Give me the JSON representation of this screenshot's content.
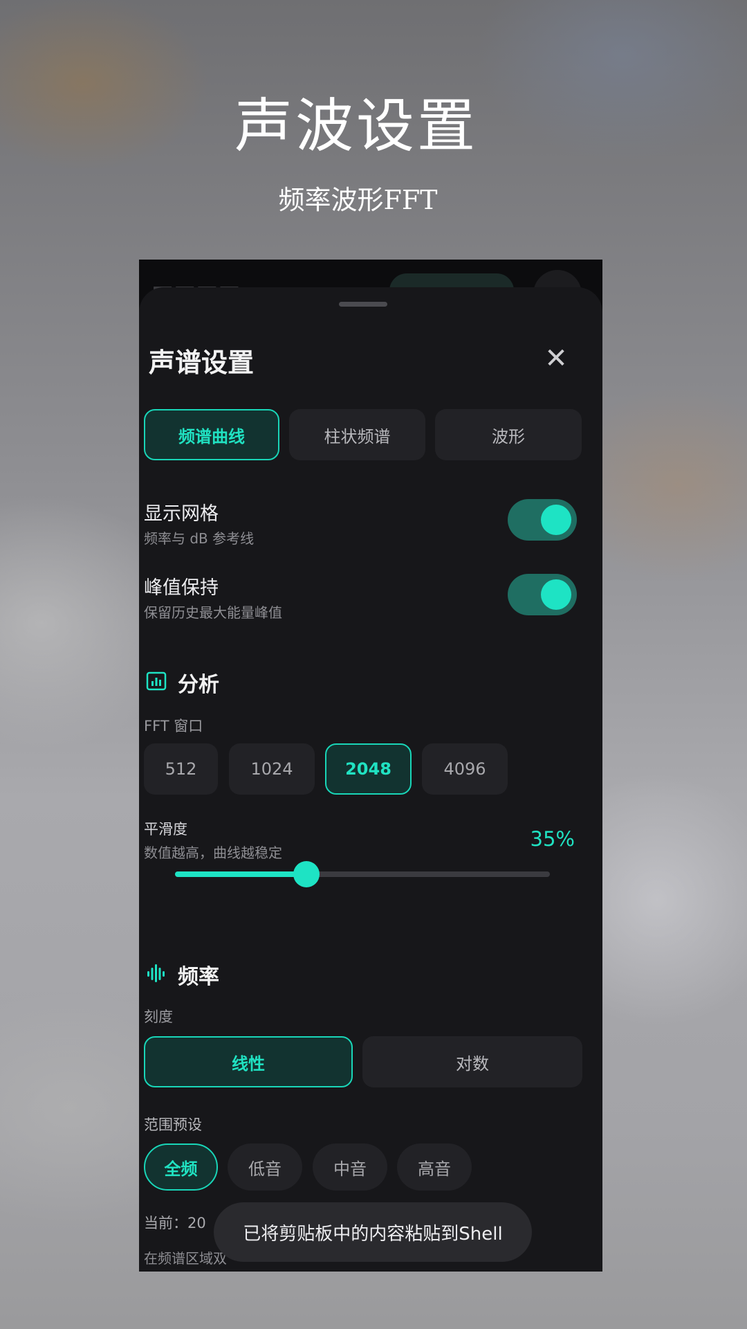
{
  "hero": {
    "title": "声波设置",
    "subtitle": "频率波形FFT"
  },
  "sheet": {
    "title": "声谱设置",
    "close_icon": "close-icon",
    "view_modes": [
      {
        "label": "频谱曲线",
        "active": true
      },
      {
        "label": "柱状频谱",
        "active": false
      },
      {
        "label": "波形",
        "active": false
      }
    ],
    "toggles": [
      {
        "label": "显示网格",
        "description": "频率与 dB 参考线",
        "on": true
      },
      {
        "label": "峰值保持",
        "description": "保留历史最大能量峰值",
        "on": true
      }
    ],
    "analysis": {
      "title": "分析",
      "icon": "chart-icon",
      "fft_label": "FFT 窗口",
      "fft_options": [
        {
          "label": "512",
          "active": false
        },
        {
          "label": "1024",
          "active": false
        },
        {
          "label": "2048",
          "active": true
        },
        {
          "label": "4096",
          "active": false
        }
      ],
      "smoothing_label": "平滑度",
      "smoothing_desc": "数值越高，曲线越稳定",
      "smoothing_value_text": "35%",
      "smoothing_fraction": 0.35
    },
    "frequency": {
      "title": "频率",
      "icon": "waveform-icon",
      "scale_label": "刻度",
      "scale_options": [
        {
          "label": "线性",
          "active": true
        },
        {
          "label": "对数",
          "active": false
        }
      ],
      "range_label": "范围预设",
      "range_options": [
        {
          "label": "全频",
          "active": true
        },
        {
          "label": "低音",
          "active": false
        },
        {
          "label": "中音",
          "active": false
        },
        {
          "label": "高音",
          "active": false
        }
      ],
      "current_text": "当前：20",
      "hint_text": "在频谱区域双"
    }
  },
  "toast": {
    "text": "已将剪贴板中的内容粘贴到Shell"
  },
  "colors": {
    "accent": "#1ee3c4",
    "sheet_bg": "#17171a",
    "chip_bg": "#222226"
  }
}
